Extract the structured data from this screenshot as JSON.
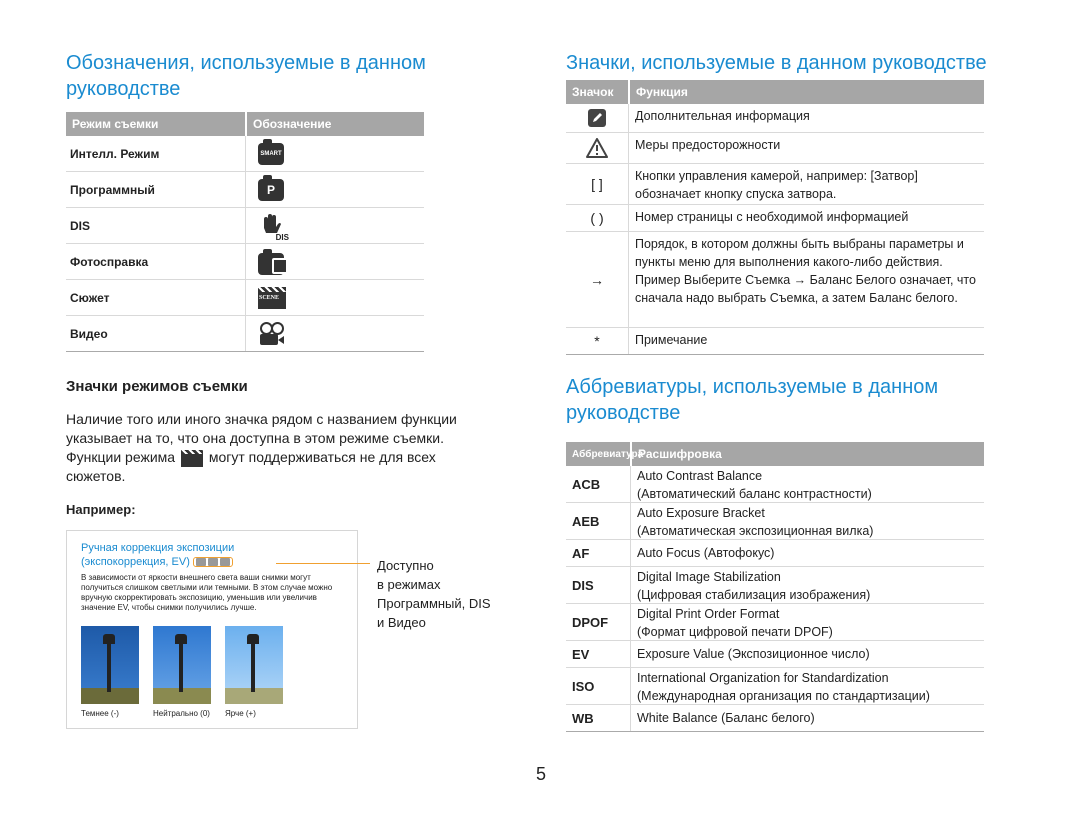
{
  "left": {
    "title": "Обозначения, используемые в данном руководстве",
    "mode_table": {
      "headers": [
        "Режим съемки",
        "Обозначение"
      ],
      "rows": [
        {
          "label": "Интелл. Режим",
          "icon": "smart-mode-icon",
          "icon_text": "SMART"
        },
        {
          "label": "Программный",
          "icon": "program-mode-icon",
          "icon_text": "P"
        },
        {
          "label": "DIS",
          "icon": "dis-mode-icon",
          "icon_text": "DIS"
        },
        {
          "label": "Фотосправка",
          "icon": "photo-help-icon",
          "icon_text": ""
        },
        {
          "label": "Сюжет",
          "icon": "scene-mode-icon",
          "icon_text": "SCENE"
        },
        {
          "label": "Видео",
          "icon": "movie-mode-icon",
          "icon_text": ""
        }
      ]
    },
    "subheading": "Значки режимов съемки",
    "paragraph_1": "Наличие того или иного значка рядом с названием функции указывает на то, что она доступна в этом режиме съемки. Функции режима",
    "paragraph_2": "могут поддерживаться не для всех сюжетов.",
    "example_label": "Например:",
    "example": {
      "heading_line1": "Ручная коррекция экспозиции",
      "heading_line2": "(экспокоррекция, EV)",
      "body": "В зависимости от яркости внешнего света ваши снимки могут получиться слишком светлыми или темными. В этом случае можно вручную скорректировать экспозицию, уменьшив или увеличив значение EV, чтобы снимки получились лучше.",
      "captions": [
        "Темнее (-)",
        "Нейтрально (0)",
        "Ярче (+)"
      ]
    },
    "callout": [
      "Доступно",
      "в режимах",
      "Программный, DIS",
      "и Видео"
    ]
  },
  "right": {
    "title": "Значки, используемые в данном руководстве",
    "icons_table": {
      "headers": [
        "Значок",
        "Функция"
      ],
      "rows": [
        {
          "symbol": "",
          "icon": "note-pencil-icon",
          "text": "Дополнительная информация"
        },
        {
          "symbol": "",
          "icon": "warning-triangle-icon",
          "text": "Меры предосторожности"
        },
        {
          "symbol": "[ ]",
          "icon": "",
          "text": "Кнопки управления камерой, например: [Затвор] обозначает кнопку спуска затвора."
        },
        {
          "symbol": "( )",
          "icon": "",
          "text": "Номер страницы с необходимой информацией"
        },
        {
          "symbol": "→",
          "icon": "",
          "text": "Порядок, в котором должны быть выбраны параметры и пункты меню для выполнения какого-либо действия. Пример Выберите Съемка → Баланс Белого означает, что сначала надо выбрать Съемка, а затем Баланс белого."
        },
        {
          "symbol": "*",
          "icon": "",
          "text": "Примечание"
        }
      ]
    },
    "abbr_title": "Аббревиатуры, используемые в данном руководстве",
    "abbr_table": {
      "headers": [
        "Аббревиатура",
        "Расшифровка"
      ],
      "rows": [
        {
          "abbr": "ACB",
          "line1": "Auto Contrast Balance",
          "line2": "(Автоматический баланс контрастности)"
        },
        {
          "abbr": "AEB",
          "line1": "Auto Exposure Bracket",
          "line2": "(Автоматическая экспозиционная вилка)"
        },
        {
          "abbr": "AF",
          "line1": "Auto Focus (Автофокус)",
          "line2": ""
        },
        {
          "abbr": "DIS",
          "line1": "Digital Image Stabilization",
          "line2": "(Цифровая стабилизация изображения)"
        },
        {
          "abbr": "DPOF",
          "line1": "Digital Print Order Format",
          "line2": "(Формат цифровой печати DPOF)"
        },
        {
          "abbr": "EV",
          "line1": "Exposure Value (Экспозиционное число)",
          "line2": ""
        },
        {
          "abbr": "ISO",
          "line1": "International Organization for Standardization",
          "line2": "(Международная организация по стандартизации)"
        },
        {
          "abbr": "WB",
          "line1": "White Balance (Баланс белого)",
          "line2": ""
        }
      ]
    }
  },
  "page_number": "5",
  "colors": {
    "heading_blue": "#1a8bd0",
    "header_gray": "#a6a6a6",
    "callout_orange": "#f0a030"
  }
}
